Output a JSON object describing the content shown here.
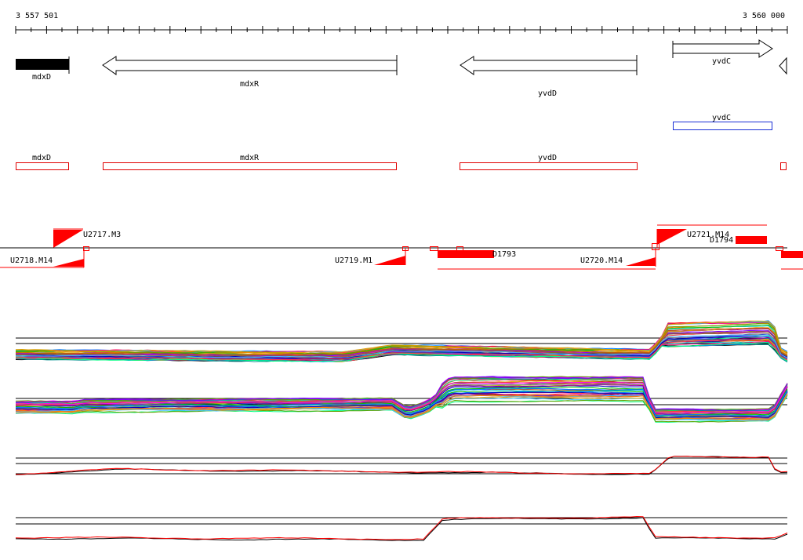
{
  "ruler": {
    "start_label": "3 557 501",
    "end_label": "3 560 000"
  },
  "genes": [
    {
      "name": "mdxD",
      "strand": "block",
      "style": "filled"
    },
    {
      "name": "mdxR",
      "strand": "reverse",
      "style": "outline"
    },
    {
      "name": "yvdD",
      "strand": "reverse",
      "style": "outline"
    },
    {
      "name": "yvdC",
      "strand": "forward",
      "style": "outline"
    }
  ],
  "cds_blue": [
    {
      "name": "yvdC"
    }
  ],
  "cds_red": [
    {
      "name": "mdxD"
    },
    {
      "name": "mdxR"
    },
    {
      "name": "yvdD"
    }
  ],
  "features": [
    {
      "name": "U2717.M3"
    },
    {
      "name": "U2718.M14"
    },
    {
      "name": "U2719.M1"
    },
    {
      "name": "U2720.M14"
    },
    {
      "name": "U2721.M14"
    },
    {
      "name": "D1793"
    },
    {
      "name": "D1794"
    }
  ],
  "colors": {
    "gene_fill": "#000000",
    "cds_outline": "#e00000",
    "cds_blue": "#1a2fd6",
    "feature_red": "#ff0000",
    "rule_black": "#000000"
  },
  "expression_tracks": [
    {
      "pattern": "low-high-low-high-drop",
      "series_count": "many"
    },
    {
      "pattern": "high-low-rise-high-low-rise",
      "series_count": "many"
    },
    {
      "pattern": "low-rise-at-end",
      "series_count": "2"
    },
    {
      "pattern": "low-rise-middle-low",
      "series_count": "2"
    }
  ]
}
